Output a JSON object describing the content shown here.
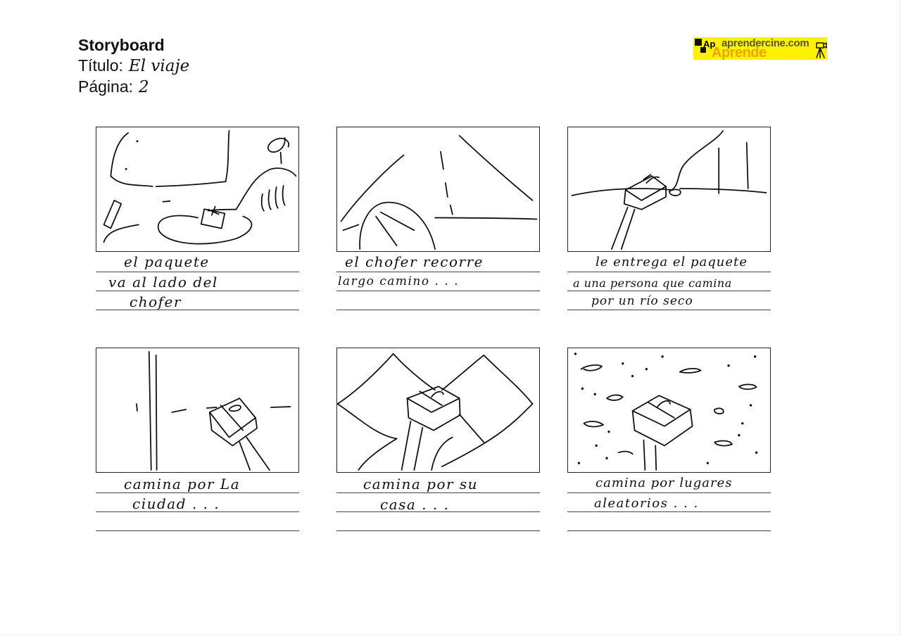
{
  "header": {
    "title": "Storyboard",
    "titulo_label": "Título:",
    "titulo_value": "El viaje",
    "pagina_label": "Página:",
    "pagina_value": "2"
  },
  "logo": {
    "url": "aprendercine.com",
    "word": "Aprende",
    "ap": "Ap"
  },
  "panels": [
    {
      "lines": [
        "el paquete",
        "va al lado del",
        "chofer"
      ]
    },
    {
      "lines": [
        "el chofer recorre",
        "largo camino . . .",
        ""
      ]
    },
    {
      "lines": [
        "le entrega el paquete",
        "a una persona que camina",
        "por un río seco"
      ]
    },
    {
      "lines": [
        "camina por La",
        "ciudad . . .",
        ""
      ]
    },
    {
      "lines": [
        "camina por su",
        "casa . . .",
        ""
      ]
    },
    {
      "lines": [
        "camina por lugares",
        "aleatorios . . .",
        ""
      ]
    }
  ]
}
